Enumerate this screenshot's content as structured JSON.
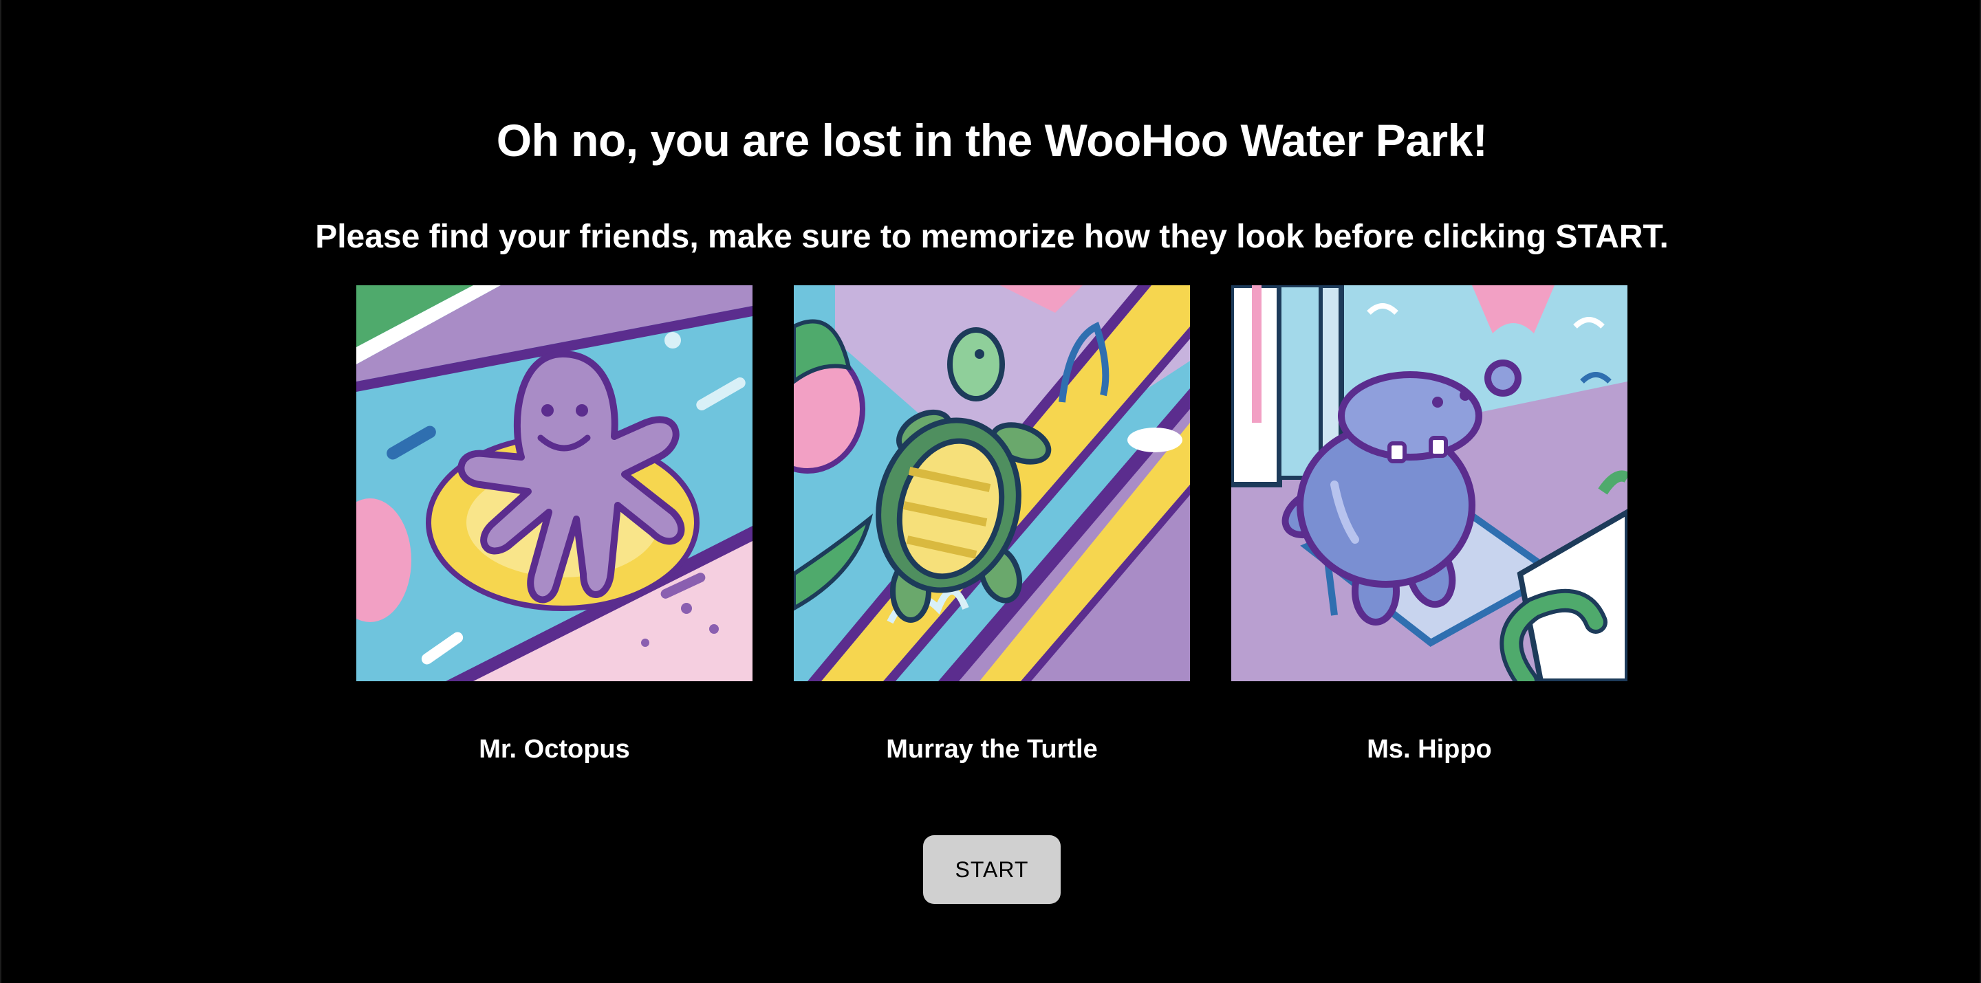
{
  "header": {
    "title": "Oh no, you are lost in the WooHoo Water Park!",
    "instructions": "Please find your friends, make sure to memorize how they look before clicking START."
  },
  "friends": [
    {
      "name": "Mr. Octopus",
      "icon": "octopus-illustration"
    },
    {
      "name": "Murray the Turtle",
      "icon": "turtle-illustration"
    },
    {
      "name": "Ms. Hippo",
      "icon": "hippo-illustration"
    }
  ],
  "actions": {
    "start_label": "START"
  },
  "colors": {
    "background": "#000000",
    "text": "#ffffff",
    "button": "#d0d0d0",
    "water": "#6fc4dd",
    "purple": "#5b2d8e",
    "lavender": "#a98cc6",
    "yellow": "#f6d64f",
    "pink": "#f2a0c4",
    "green": "#4faa6c"
  }
}
